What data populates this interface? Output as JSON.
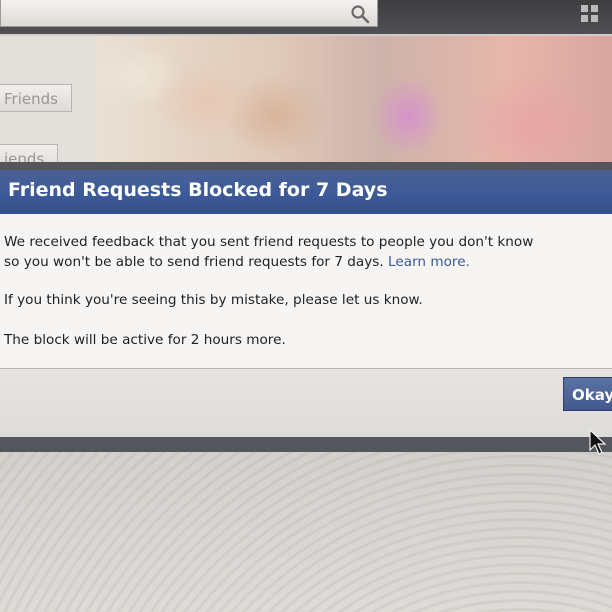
{
  "top": {
    "search_icon": "search-icon",
    "corner_icon": "grid-icon"
  },
  "sidebar": {
    "items": [
      {
        "label": "Friends"
      },
      {
        "label": "iends"
      }
    ]
  },
  "dialog": {
    "title": "Friend Requests Blocked for 7 Days",
    "line1": "We received feedback that you sent friend requests to people you don't know",
    "line2_prefix": "so you won't be able to send friend requests for 7 days. ",
    "learn_more": "Learn more.",
    "line3": "If you think you're seeing this by mistake, please let us know.",
    "line4": "The block will be active for 2 hours more.",
    "okay_label": "Okay"
  },
  "colors": {
    "header_blue": "#3b5998",
    "button_blue": "#4b629a",
    "link_blue": "#3b5998"
  }
}
